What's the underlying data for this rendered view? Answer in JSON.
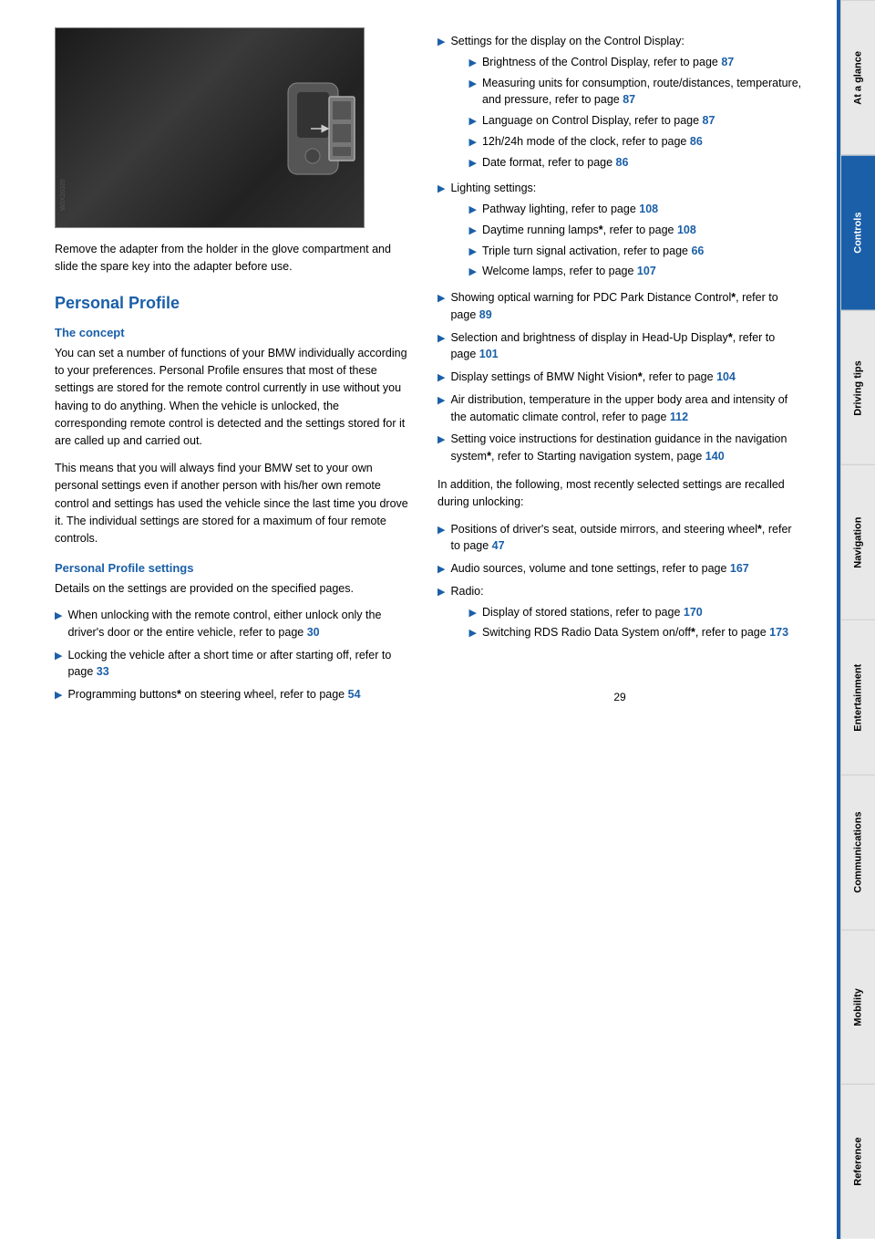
{
  "page": {
    "number": "29"
  },
  "sidebar": {
    "tabs": [
      {
        "id": "at-a-glance",
        "label": "At a glance",
        "active": false
      },
      {
        "id": "controls",
        "label": "Controls",
        "active": true
      },
      {
        "id": "driving-tips",
        "label": "Driving tips",
        "active": false
      },
      {
        "id": "navigation",
        "label": "Navigation",
        "active": false
      },
      {
        "id": "entertainment",
        "label": "Entertainment",
        "active": false
      },
      {
        "id": "communications",
        "label": "Communications",
        "active": false
      },
      {
        "id": "mobility",
        "label": "Mobility",
        "active": false
      },
      {
        "id": "reference",
        "label": "Reference",
        "active": false
      }
    ]
  },
  "left_col": {
    "image_caption": "Remove the adapter from the holder in the glove compartment and slide the spare key into the adapter before use.",
    "personal_profile_title": "Personal Profile",
    "concept_title": "The concept",
    "concept_body_1": "You can set a number of functions of your BMW individually according to your preferences. Personal Profile ensures that most of these settings are stored for the remote control currently in use without you having to do anything. When the vehicle is unlocked, the corresponding remote control is detected and the settings stored for it are called up and carried out.",
    "concept_body_2": "This means that you will always find your BMW set to your own personal settings even if another person with his/her own remote control and settings has used the vehicle since the last time you drove it. The individual settings are stored for a maximum of four remote controls.",
    "settings_title": "Personal Profile settings",
    "settings_intro": "Details on the settings are provided on the specified pages.",
    "bullets": [
      {
        "text_before": "When unlocking with the remote control, either unlock only the driver's door or the entire vehicle, refer to page ",
        "link_text": "30",
        "text_after": ""
      },
      {
        "text_before": "Locking the vehicle after a short time or after starting off, refer to page ",
        "link_text": "33",
        "text_after": ""
      },
      {
        "text_before": "Programming buttons",
        "star": "*",
        "text_mid": " on steering wheel, refer to page ",
        "link_text": "54",
        "text_after": ""
      }
    ]
  },
  "right_col": {
    "bullets": [
      {
        "text_before": "Settings for the display on the Control Display:",
        "sub_bullets": [
          {
            "text_before": "Brightness of the Control Display, refer to page ",
            "link_text": "87"
          },
          {
            "text_before": "Measuring units for consumption, route/distances, temperature, and pressure, refer to page ",
            "link_text": "87"
          },
          {
            "text_before": "Language on Control Display, refer to page ",
            "link_text": "87"
          },
          {
            "text_before": "12h/24h mode of the clock, refer to page ",
            "link_text": "86"
          },
          {
            "text_before": "Date format, refer to page ",
            "link_text": "86"
          }
        ]
      },
      {
        "text_before": "Lighting settings:",
        "sub_bullets": [
          {
            "text_before": "Pathway lighting, refer to page ",
            "link_text": "108"
          },
          {
            "text_before": "Daytime running lamps",
            "star": "*",
            "text_mid": ", refer to page ",
            "link_text": "108"
          },
          {
            "text_before": "Triple turn signal activation, refer to page ",
            "link_text": "66"
          },
          {
            "text_before": "Welcome lamps, refer to page ",
            "link_text": "107"
          }
        ]
      },
      {
        "text_before": "Showing optical warning for PDC Park Distance Control",
        "star": "*",
        "text_mid": ", refer to page ",
        "link_text": "89"
      },
      {
        "text_before": "Selection and brightness of display in Head-Up Display",
        "star": "*",
        "text_mid": ", refer to page ",
        "link_text": "101"
      },
      {
        "text_before": "Display settings of BMW Night Vision",
        "star": "*",
        "text_mid": ", refer to page ",
        "link_text": "104"
      },
      {
        "text_before": "Air distribution, temperature in the upper body area and intensity of the automatic climate control, refer to page ",
        "link_text": "112"
      },
      {
        "text_before": "Setting voice instructions for destination guidance in the navigation system",
        "star": "*",
        "text_mid": ", refer to Starting navigation system, page ",
        "link_text": "140"
      }
    ],
    "also_recalled_intro": "In addition, the following, most recently selected settings are recalled during unlocking:",
    "also_recalled_bullets": [
      {
        "text_before": "Positions of driver's seat, outside mirrors, and steering wheel",
        "star": "*",
        "text_mid": ", refer to page ",
        "link_text": "47"
      },
      {
        "text_before": "Audio sources, volume and tone settings, refer to page ",
        "link_text": "167"
      },
      {
        "text_before": "Radio:",
        "sub_bullets": [
          {
            "text_before": "Display of stored stations, refer to page ",
            "link_text": "170"
          },
          {
            "text_before": "Switching RDS Radio Data System on/off",
            "star": "*",
            "text_mid": ", refer to page ",
            "link_text": "173"
          }
        ]
      }
    ]
  }
}
